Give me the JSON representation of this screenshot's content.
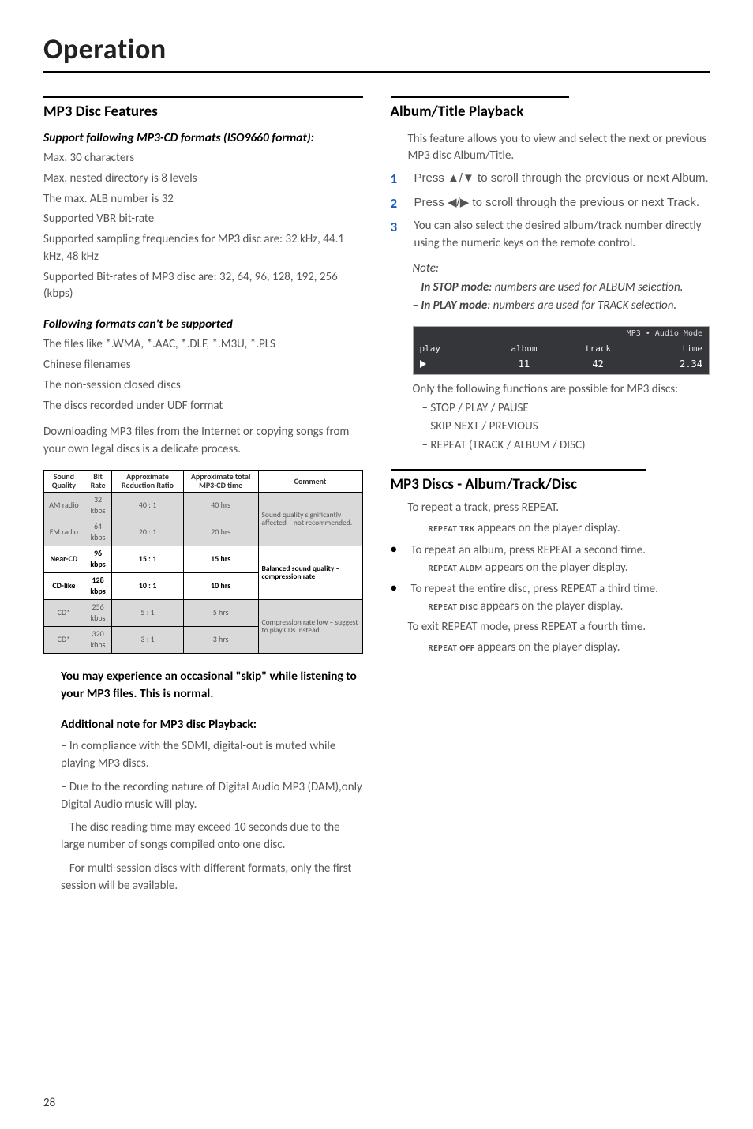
{
  "page_title": "Operation",
  "page_number": "28",
  "left": {
    "h1": "MP3 Disc Features",
    "sub1": "Support following MP3-CD formats (ISO9660 format):",
    "sub1_lines": [
      "Max. 30 characters",
      "Max. nested directory is 8 levels",
      "The max. ALB number is 32",
      "Supported VBR bit-rate",
      "Supported sampling frequencies for MP3 disc are: 32 kHz, 44.1 kHz, 48 kHz",
      "Supported Bit-rates of MP3 disc are: 32, 64, 96, 128, 192, 256 (kbps)"
    ],
    "sub2": "Following formats can't be supported",
    "sub2_lines": [
      "The files like *.WMA, *.AAC, *.DLF, *.M3U, *.PLS",
      "Chinese filenames",
      "The non-session closed discs",
      "The discs recorded under UDF format"
    ],
    "para_dl": "Downloading MP3 files from the Internet or copying songs from your own legal discs is a delicate process.",
    "table": {
      "headers": [
        "Sound Quality",
        "Bit Rate",
        "Approximate Reduction Ratio",
        "Approximate total MP3-CD time",
        "Comment"
      ],
      "rows": [
        {
          "cells": [
            "AM radio",
            "32 kbps",
            "40 : 1",
            "40 hrs"
          ],
          "comment": "Sound quality significantly affected – not recommended.",
          "shade": true,
          "rowspan": 2
        },
        {
          "cells": [
            "FM radio",
            "64 kbps",
            "20 : 1",
            "20 hrs"
          ],
          "shade": true
        },
        {
          "cells": [
            "Near-CD",
            "96 kbps",
            "15 : 1",
            "15 hrs"
          ],
          "comment": "Balanced sound quality – compression rate",
          "bold": true,
          "rowspan": 2
        },
        {
          "cells": [
            "CD-like",
            "128 kbps",
            "10 : 1",
            "10 hrs"
          ],
          "bold": true
        },
        {
          "cells": [
            "CD*",
            "256 kbps",
            "5 : 1",
            "5 hrs"
          ],
          "comment": "Compression rate low – suggest to play CDs instead",
          "shade": true,
          "rowspan": 2
        },
        {
          "cells": [
            "CD*",
            "320 kbps",
            "3 : 1",
            "3 hrs"
          ],
          "shade": true
        }
      ]
    },
    "skip_note": "You may experience an occasional \"skip\" while listening to your MP3 files. This is normal.",
    "add_head": "Additional note for MP3 disc Playback:",
    "add_items": [
      "– In compliance with the SDMI, digital-out is muted while playing MP3 discs.",
      "– Due to the recording nature of Digital Audio MP3 (DAM),only Digital Audio music will play.",
      "– The disc reading time may exceed 10 seconds due to the large number of songs compiled onto one disc.",
      "– For multi-session discs with different formats, only the first session will be available."
    ]
  },
  "right": {
    "h1": "Album/Title Playback",
    "intro": "This feature allows you to view and select the next or previous MP3 disc Album/Title.",
    "steps": [
      {
        "n": "1",
        "t": "Press ▲/▼ to scroll through the previous or next Album."
      },
      {
        "n": "2",
        "t": "Press ◀/▶ to scroll through the previous or next Track."
      },
      {
        "n": "3",
        "t": "You can also select the desired album/track number directly using the numeric keys on the remote control."
      }
    ],
    "note_title": "Note:",
    "note_lines": [
      {
        "pre": "–   ",
        "b": "In STOP mode",
        "post": ": numbers are used for ALBUM selection."
      },
      {
        "pre": "–   ",
        "b": "In PLAY mode",
        "post": ": numbers are used for TRACK selection."
      }
    ],
    "status": {
      "top_right": "MP3 • Audio Mode",
      "h": [
        "play",
        "album",
        "track",
        "time"
      ],
      "v": [
        "▶",
        "11",
        "42",
        "2.34"
      ]
    },
    "after_status": "Only the following functions are possible for MP3 discs:",
    "dash": [
      "–  STOP / PLAY / PAUSE",
      "–  SKIP NEXT / PREVIOUS",
      "–  REPEAT (TRACK / ALBUM / DISC)"
    ],
    "h2": "MP3 Discs - Album/Track/Disc",
    "rpt_intro": "To repeat a track, press REPEAT.",
    "rpt_lines": [
      {
        "sc": "REPEAT TRK",
        "post": " appears on the player display."
      }
    ],
    "bul1": "To repeat an album, press REPEAT a second time.",
    "bul1_sub": {
      "sc": "REPEAT ALBM",
      "post": " appears on the player display."
    },
    "bul2": "To repeat the entire disc, press REPEAT a third time.",
    "bul2_sub": {
      "sc": "REPEAT DISC",
      "post": " appears on the player display."
    },
    "exit": "To exit REPEAT mode, press REPEAT a fourth time.",
    "exit_sub": {
      "sc": "REPEAT OFF",
      "post": " appears on the player display."
    }
  }
}
